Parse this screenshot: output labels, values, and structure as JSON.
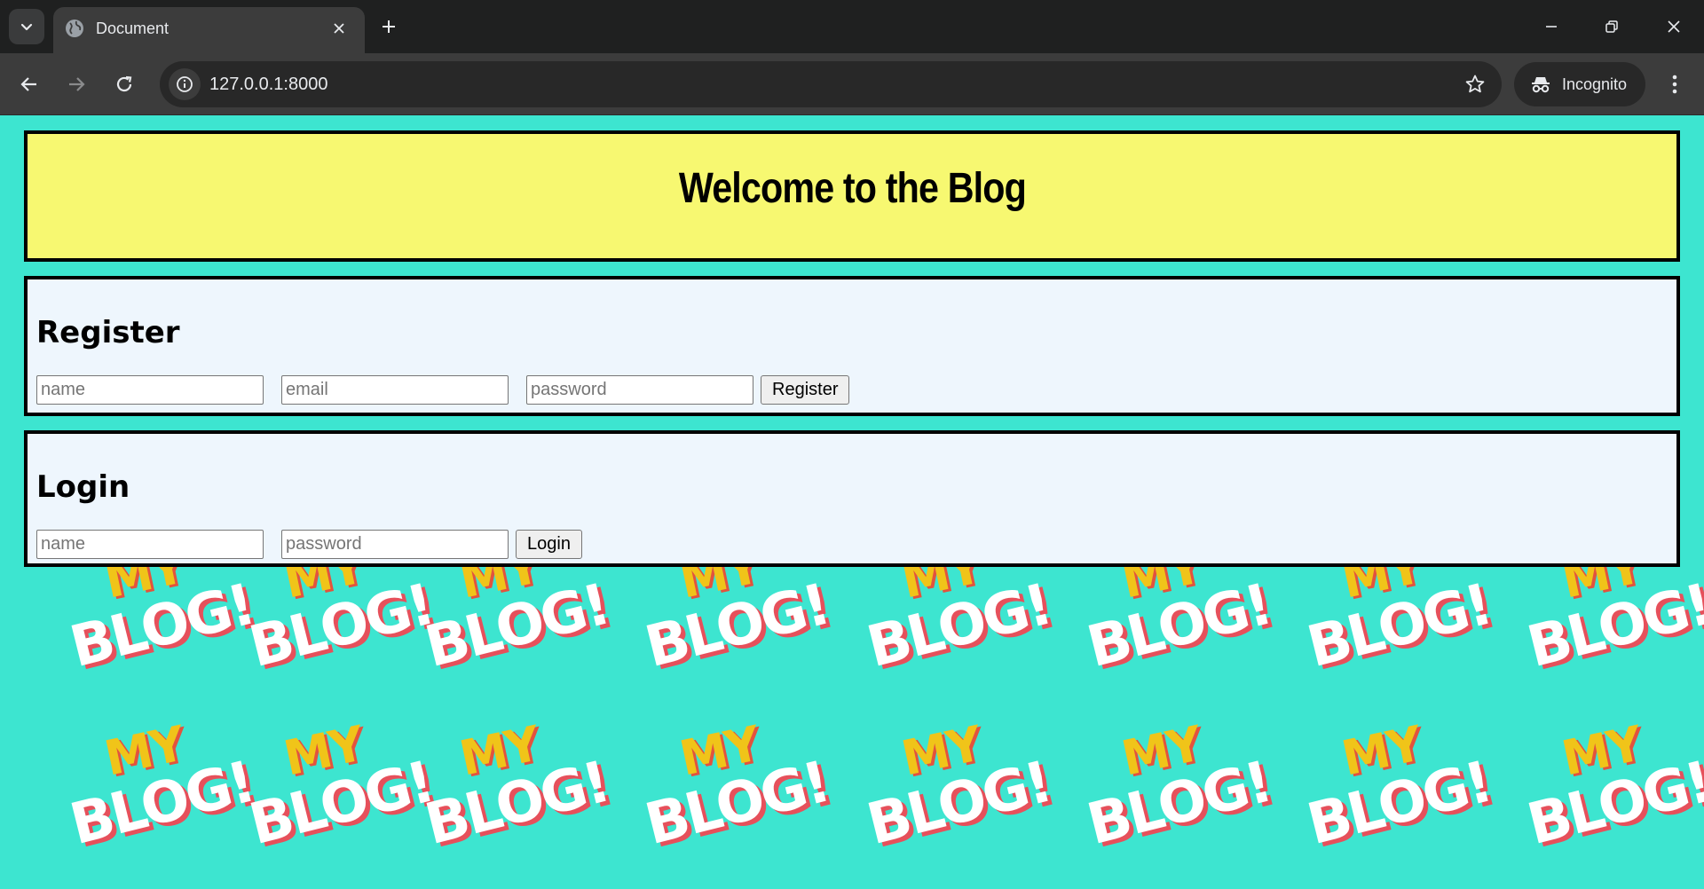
{
  "browser": {
    "tab_title": "Document",
    "url": "127.0.0.1:8000",
    "profile_label": "Incognito",
    "icons": [
      "tab-search-icon",
      "globe-icon",
      "close-icon",
      "plus-icon",
      "minimize-icon",
      "restore-icon",
      "close-window-icon",
      "back-arrow-icon",
      "forward-arrow-icon",
      "reload-icon",
      "info-icon",
      "star-icon",
      "incognito-icon",
      "kebab-menu-icon"
    ]
  },
  "background": {
    "tile_top": "MY",
    "tile_bottom": "BLOG!",
    "color": "#3de5d0"
  },
  "header": {
    "title": "Welcome to the Blog",
    "color": "#f7f871"
  },
  "register": {
    "heading": "Register",
    "name_placeholder": "name",
    "email_placeholder": "email",
    "password_placeholder": "password",
    "button_label": "Register"
  },
  "login": {
    "heading": "Login",
    "name_placeholder": "name",
    "password_placeholder": "password",
    "button_label": "Login"
  }
}
